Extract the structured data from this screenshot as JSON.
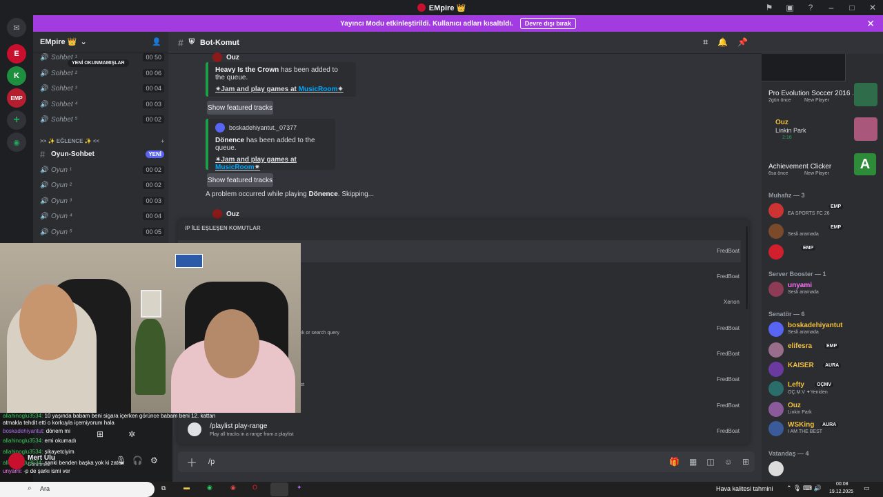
{
  "window": {
    "title": "EMpire 👑"
  },
  "banner": {
    "text": "Yayıncı Modu etkinleştirildi. Kullanıcı adları kısaltıldı.",
    "button": "Devre dışı bırak"
  },
  "server": {
    "name": "EMpire 👑",
    "tooltip": "YENİ OKUNMAMIŞLAR"
  },
  "channels": [
    {
      "name": "Sohbet ¹",
      "count": "00  50"
    },
    {
      "name": "Sohbet ²",
      "count": "00  06"
    },
    {
      "name": "Sohbet ³",
      "count": "00  04"
    },
    {
      "name": "Sohbet ⁴",
      "count": "00  03"
    },
    {
      "name": "Sohbet ⁵",
      "count": "00  02"
    }
  ],
  "category": ">> ✨ EĞLENCE ✨ <<",
  "text_channel": {
    "name": "Oyun-Sohbet",
    "badge": "YENİ"
  },
  "game_channels": [
    {
      "name": "Oyun ¹",
      "count": "00  02"
    },
    {
      "name": "Oyun ²",
      "count": "00  02"
    },
    {
      "name": "Oyun ³",
      "count": "00  03"
    },
    {
      "name": "Oyun ⁴",
      "count": "00  04"
    },
    {
      "name": "Oyun ⁵",
      "count": "00  05"
    }
  ],
  "channel_header": {
    "name": "Bot-Komut"
  },
  "messages": {
    "author1": "Ouz",
    "embed1_track": "Heavy Is the Crown",
    "embed1_text": "has been added to the queue.",
    "jam_text": "Jam and play games at",
    "jam_link": "MusicRoom",
    "featured": "Show featured tracks",
    "embed2_author": "boskadehiyantut._07377",
    "embed2_track": "Dönence",
    "embed2_text": "has been added to the queue.",
    "problem_pre": "A problem occurred while playing",
    "problem_track": "Dönence",
    "problem_post": ". Skipping...",
    "author2": "Ouz"
  },
  "command_popup": {
    "title": "/P İLE EŞLEŞEN KOMUTLAR",
    "providers": [
      "FredBoat",
      "FredBoat",
      "Xenon",
      "FredBoat",
      "FredBoat",
      "FredBoat",
      "FredBoat",
      "FredBoat"
    ],
    "frag1": "nk or search query",
    "frag2": "ist",
    "last_command": "/playlist play-range",
    "last_desc": "Play all tracks in a range from a playlist"
  },
  "input": {
    "value": "/p"
  },
  "twitch_chat": [
    {
      "user": "allahinoglu3534:",
      "msg": "10 yaşında babam beni sigara içerken görünce babam beni 12. kattan"
    },
    {
      "user": "",
      "msg": "atmakla tehdit etti o korkuyla içemiyorum hala"
    },
    {
      "user": "boskadehiyantut:",
      "msg": "dönem mi"
    },
    {
      "user": "allahinoglu3534:",
      "msg": "emi okumadı"
    },
    {
      "user": "allahinoglu3534:",
      "msg": "şikayetciyim"
    },
    {
      "user": "allahinoglu3534:",
      "msg": "sanki benden başka yok ki zaten"
    },
    {
      "user": "unyami:",
      "msg": "-p de şarkı ismi ver"
    }
  ],
  "user_panel": {
    "name": "Mert Ulu",
    "status": "Görünmez"
  },
  "members": {
    "activity": [
      {
        "name": "Pro Evolution Soccer 2016 ...",
        "sub": "2gün önce",
        "tag": "New Player"
      },
      {
        "name": "Ouz",
        "sub": "Linkin Park",
        "time": "2:16"
      },
      {
        "name": "Achievement Clicker",
        "sub": "6sa önce",
        "tag": "New Player"
      }
    ],
    "groups": [
      {
        "title": "Muhafız — 3",
        "items": [
          {
            "name": "",
            "status": "EA SPORTS FC 26",
            "badge": "EMP",
            "color": "#e04b4b"
          },
          {
            "name": "",
            "status": "Sesli aramada",
            "badge": "EMP",
            "color": "#e04b4b"
          },
          {
            "name": "",
            "status": "",
            "badge": "EMP",
            "color": "#e04b4b"
          }
        ]
      },
      {
        "title": "Server Booster — 1",
        "items": [
          {
            "name": "unyami",
            "status": "Sesli aramada",
            "badge": "",
            "color": "#ff73fa"
          }
        ]
      },
      {
        "title": "Senatör — 6",
        "items": [
          {
            "name": "boskadehiyantut",
            "status": "Sesli aramada",
            "badge": "",
            "color": "#f0c040"
          },
          {
            "name": "elifesra",
            "status": "",
            "badge": "EMP",
            "color": "#f0c040"
          },
          {
            "name": "KAISER",
            "status": "",
            "badge": "AURA",
            "color": "#f0c040"
          },
          {
            "name": "Lefty",
            "status": "OÇ.M.V ✦Yeniden",
            "badge": "OÇMV",
            "color": "#f0c040"
          },
          {
            "name": "Ouz",
            "status": "Linkin Park",
            "badge": "",
            "color": "#f0c040"
          },
          {
            "name": "WSKing",
            "status": "I AM THE BEST",
            "badge": "AURA",
            "color": "#f0c040"
          }
        ]
      },
      {
        "title": "Vatandaş — 4",
        "items": []
      }
    ]
  },
  "taskbar": {
    "search": "Ara",
    "weather": "Hava kalitesi tahmini",
    "time": "00:08",
    "date": "19.12.2025"
  }
}
